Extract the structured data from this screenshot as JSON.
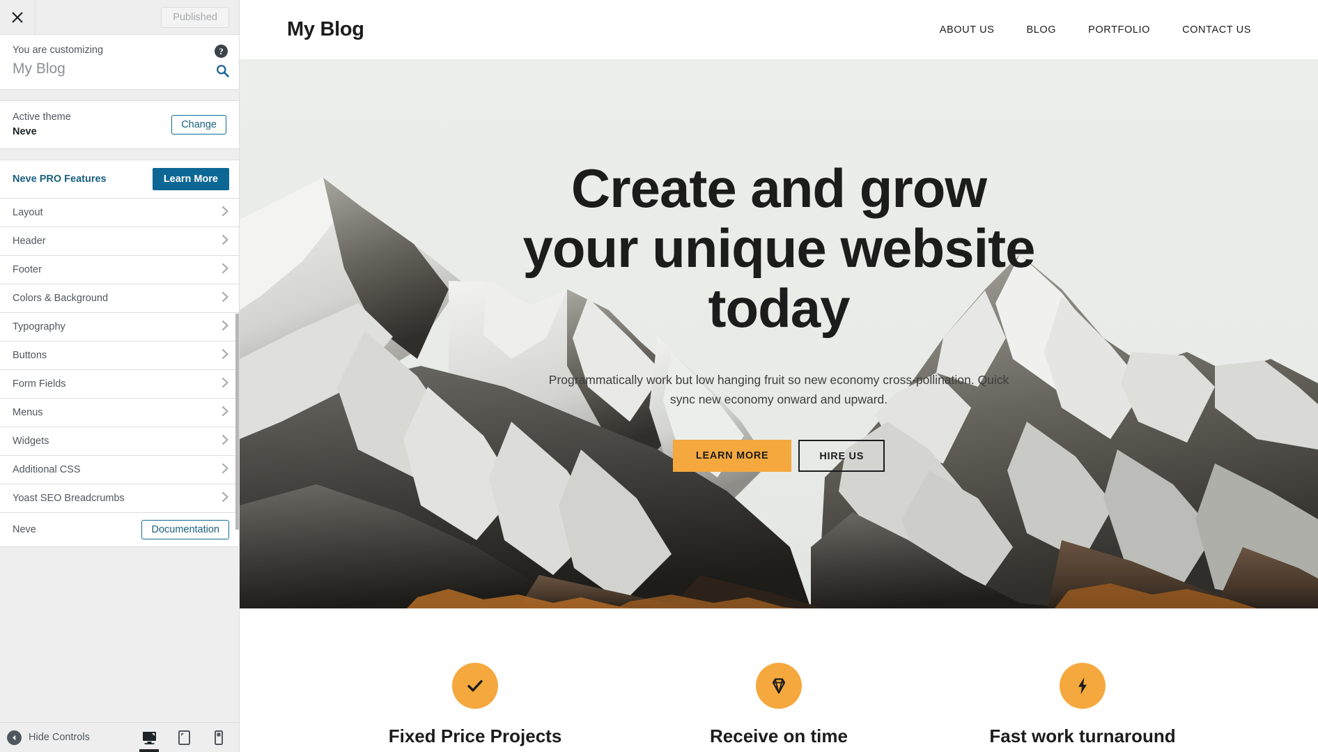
{
  "customizer": {
    "close_icon": "close-icon",
    "publish_button": "Published",
    "info": {
      "label": "You are customizing",
      "title": "My Blog",
      "help_icon": "help-icon",
      "search_icon": "search-icon"
    },
    "theme": {
      "label": "Active theme",
      "name": "Neve",
      "change_button": "Change"
    },
    "pro": {
      "label": "Neve PRO Features",
      "button": "Learn More"
    },
    "sections": [
      {
        "label": "Layout"
      },
      {
        "label": "Header"
      },
      {
        "label": "Footer"
      },
      {
        "label": "Colors & Background"
      },
      {
        "label": "Typography"
      },
      {
        "label": "Buttons"
      },
      {
        "label": "Form Fields"
      },
      {
        "label": "Menus"
      },
      {
        "label": "Widgets"
      },
      {
        "label": "Additional CSS"
      },
      {
        "label": "Yoast SEO Breadcrumbs"
      }
    ],
    "footer_row": {
      "label": "Neve",
      "button": "Documentation"
    },
    "bottom_bar": {
      "hide_controls": "Hide Controls",
      "devices": [
        {
          "name": "desktop",
          "active": true
        },
        {
          "name": "tablet",
          "active": false
        },
        {
          "name": "mobile",
          "active": false
        }
      ]
    }
  },
  "site": {
    "logo": "My Blog",
    "nav": [
      {
        "label": "ABOUT US"
      },
      {
        "label": "BLOG"
      },
      {
        "label": "PORTFOLIO"
      },
      {
        "label": "CONTACT US"
      }
    ],
    "hero": {
      "title": "Create and grow your unique website today",
      "subtitle": "Programmatically work but low hanging fruit so new economy cross-pollination. Quick sync new economy onward and upward.",
      "primary_button": "LEARN MORE",
      "secondary_button": "HIRE US"
    },
    "features": [
      {
        "title": "Fixed Price Projects",
        "icon": "check-icon"
      },
      {
        "title": "Receive on time",
        "icon": "gem-icon"
      },
      {
        "title": "Fast work turnaround",
        "icon": "bolt-icon"
      }
    ]
  },
  "colors": {
    "accent_orange": "#f5a83e",
    "wp_blue": "#0d6795",
    "sidebar_bg": "#eeeeee",
    "text_dark": "#1c1c1c"
  }
}
